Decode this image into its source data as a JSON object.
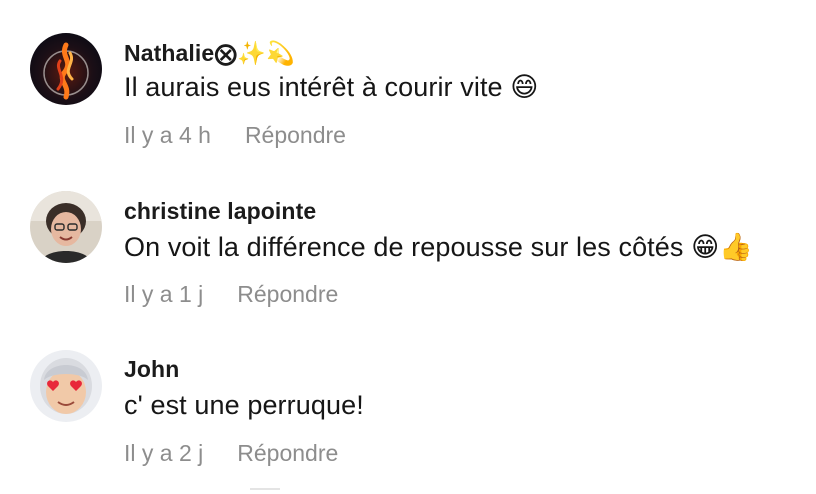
{
  "comments": [
    {
      "author": "Nathalie⨂✨💫",
      "text": "Il aurais eus intérêt à courir vite 😄",
      "time": "Il y a 4 h",
      "reply_label": "Répondre"
    },
    {
      "author": "christine lapointe",
      "text": "On voit la différence de repousse sur les côtés 😁👍",
      "time": "Il y a 1 j",
      "reply_label": "Répondre"
    },
    {
      "author": "John",
      "text": "c' est une perruque!",
      "time": "Il y a 2 j",
      "reply_label": "Répondre"
    }
  ]
}
